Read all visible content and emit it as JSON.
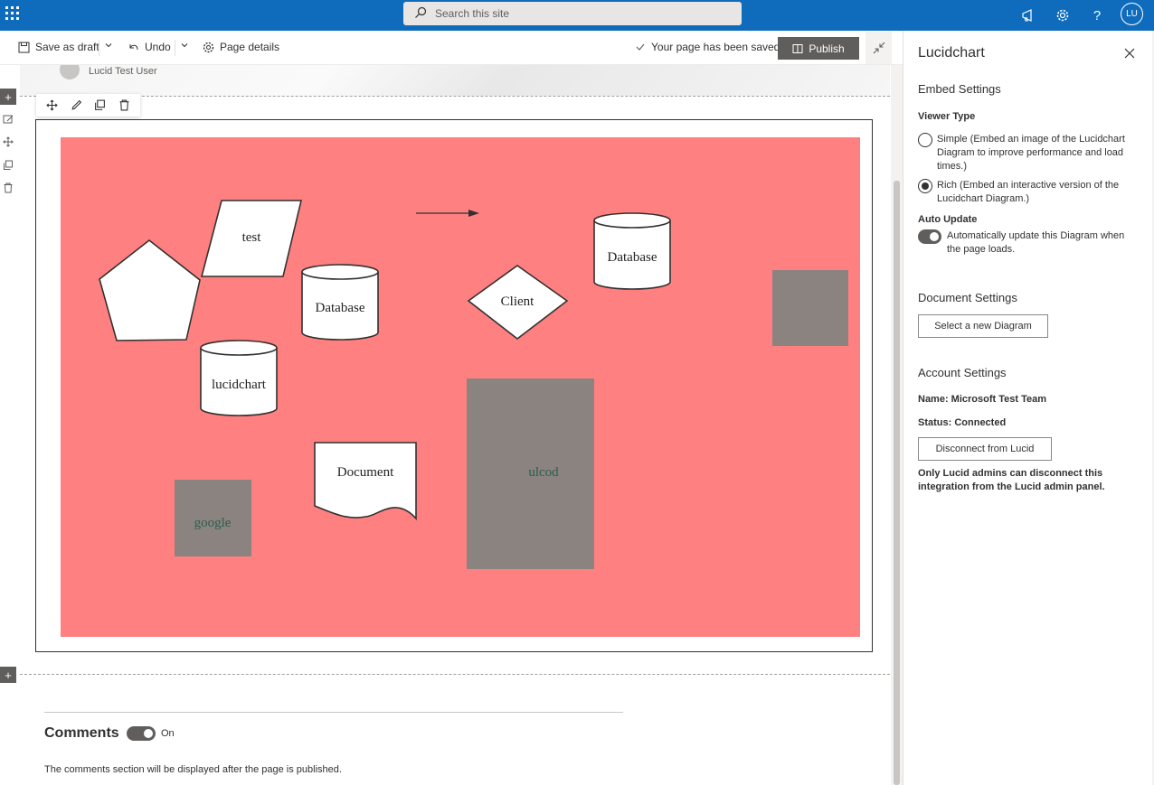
{
  "suite_bar": {
    "search_placeholder": "Search this site",
    "avatar_initials": "LU",
    "icons": [
      "app-launcher-icon",
      "megaphone-icon",
      "gear-icon",
      "help-icon"
    ]
  },
  "command_bar": {
    "save_as_draft": "Save as draft",
    "undo": "Undo",
    "page_details": "Page details",
    "saved_status": "Your page has been saved",
    "publish": "Publish"
  },
  "page": {
    "author_name": "Lucid Test User"
  },
  "diagram": {
    "background_color": "#ff8080",
    "shape_fill": "#ffffff",
    "block_color": "#8b837f",
    "block_text_color": "#2e5e4e",
    "labels": {
      "test": "test",
      "database_1": "Database",
      "database_2": "Database",
      "client": "Client",
      "lucidchart": "lucidchart",
      "document": "Document",
      "google": "google",
      "ulcod": "ulcod"
    }
  },
  "comments": {
    "title": "Comments",
    "toggle_label": "On",
    "note": "The comments section will be displayed after the page is published."
  },
  "panel": {
    "title": "Lucidchart",
    "embed_settings": "Embed Settings",
    "viewer_type_label": "Viewer Type",
    "viewer_options": [
      {
        "text": "Simple (Embed an image of the Lucidchart Diagram to improve performance and load times.)",
        "selected": false
      },
      {
        "text": "Rich (Embed an interactive version of the Lucidchart Diagram.)",
        "selected": true
      }
    ],
    "auto_update_label": "Auto Update",
    "auto_update_text": "Automatically update this Diagram when the page loads.",
    "auto_update_on": true,
    "document_settings": "Document Settings",
    "select_diagram_button": "Select a new Diagram",
    "account_settings": "Account Settings",
    "account_name": "Name: Microsoft Test Team",
    "account_status": "Status: Connected",
    "disconnect_button": "Disconnect from Lucid",
    "admin_note": "Only Lucid admins can disconnect this integration from the Lucid admin panel."
  }
}
